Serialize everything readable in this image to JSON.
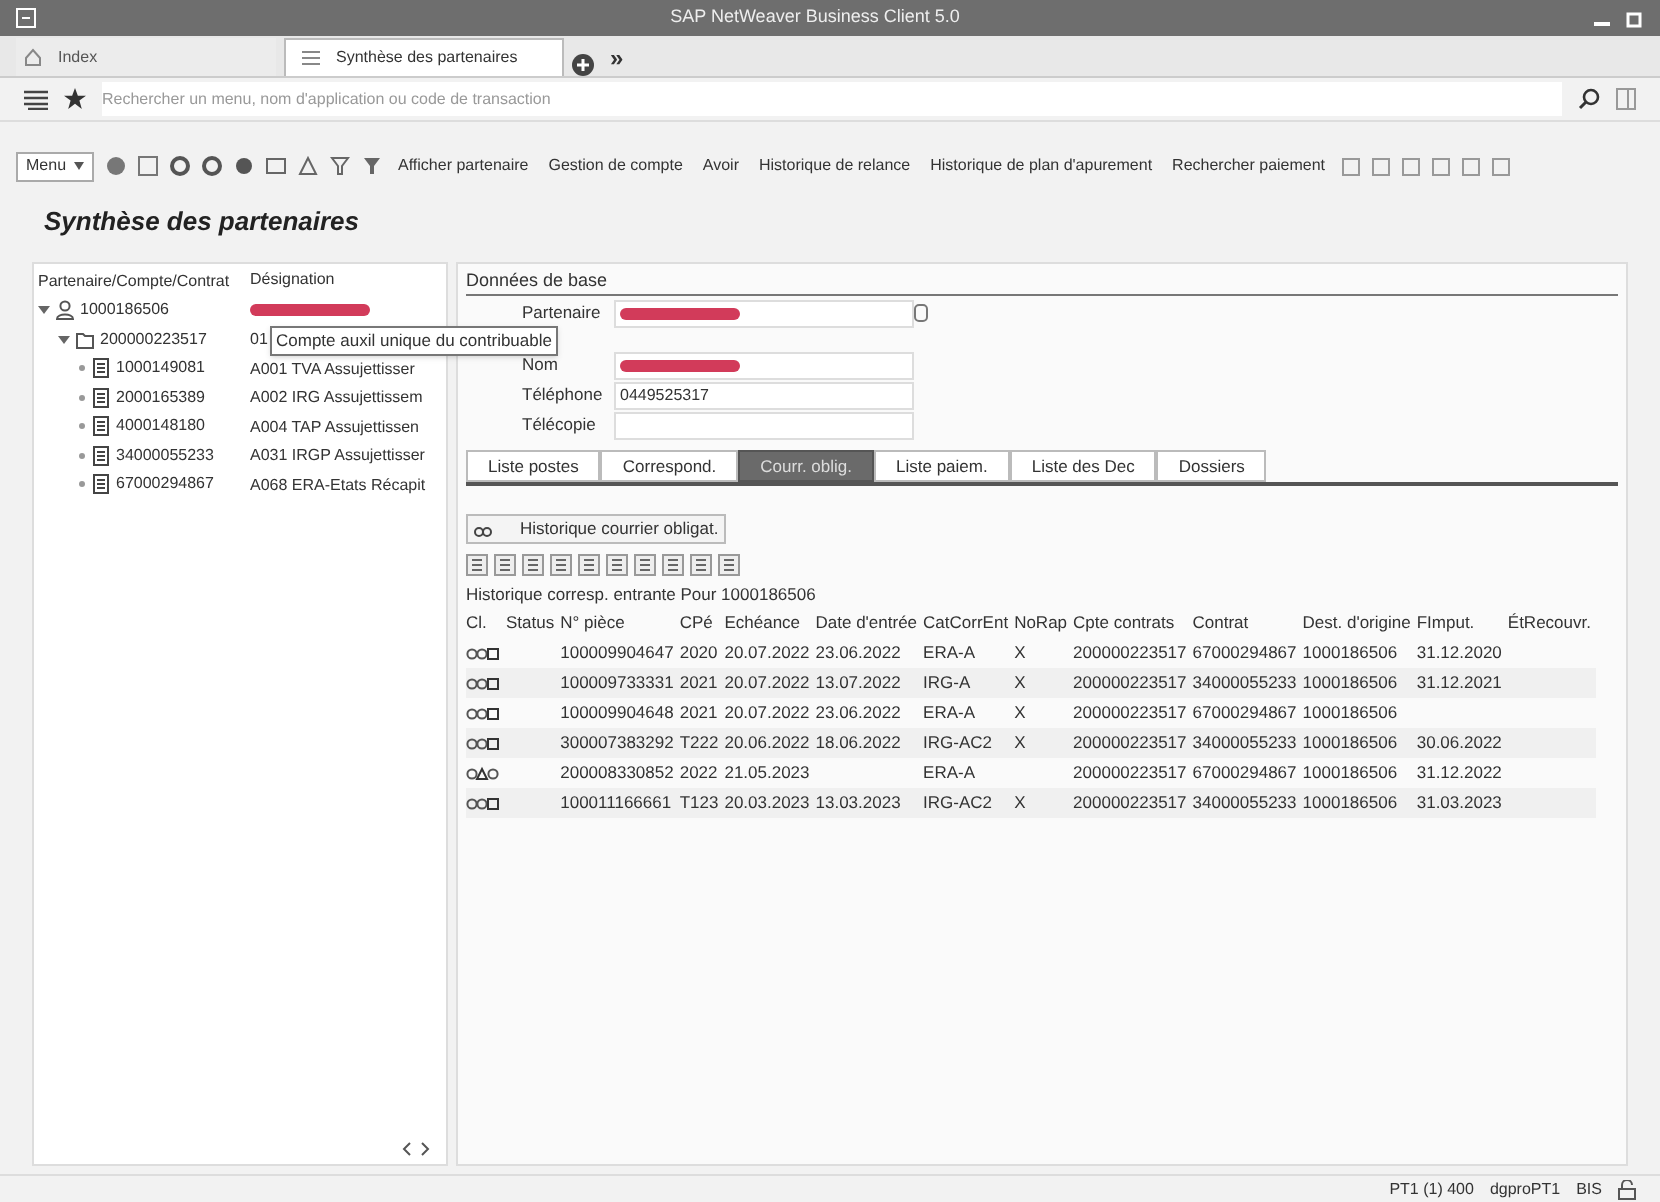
{
  "window": {
    "title": "SAP NetWeaver Business Client 5.0"
  },
  "tabs": [
    {
      "label": "Index",
      "selected": false
    },
    {
      "label": "Synthèse des partenaires",
      "selected": true
    }
  ],
  "more_tabs": "»",
  "search": {
    "placeholder": "Rechercher un menu, nom d'application ou code de transaction"
  },
  "toolbar": {
    "menu": "Menu",
    "buttons": [
      "Afficher partenaire",
      "Gestion de compte",
      "Avoir",
      "Historique de relance",
      "Historique de plan d'apurement",
      "Rechercher paiement"
    ]
  },
  "page_title": "Synthèse des partenaires",
  "tree": {
    "columns": [
      "Partenaire/Compte/Contrat",
      "Désignation"
    ],
    "nodes": [
      {
        "kind": "partner",
        "id": "1000186506",
        "expanded": true,
        "children": [
          {
            "kind": "account",
            "id": "200000223517",
            "designation": "01",
            "expanded": true,
            "children": [
              {
                "kind": "contract",
                "id": "1000149081",
                "designation": "A001 TVA Assujettisser"
              },
              {
                "kind": "contract",
                "id": "2000165389",
                "designation": "A002 IRG Assujettissem"
              },
              {
                "kind": "contract",
                "id": "4000148180",
                "designation": "A004 TAP Assujettissen"
              },
              {
                "kind": "contract",
                "id": "34000055233",
                "designation": "A031 IRGP Assujettisser"
              },
              {
                "kind": "contract",
                "id": "67000294867",
                "designation": "A068 ERA-Etats Récapit"
              }
            ]
          }
        ]
      }
    ]
  },
  "tooltip": "Compte auxil unique du contribuable",
  "basic_data": {
    "title": "Données de base",
    "fields": [
      {
        "label": "Partenaire"
      },
      {
        "label": "Nom"
      },
      {
        "label": "Téléphone",
        "value": "0449525317"
      },
      {
        "label": "Télécopie"
      }
    ]
  },
  "detail_tabs": [
    {
      "label": "Liste postes",
      "selected": false
    },
    {
      "label": "Correspond.",
      "selected": false
    },
    {
      "label": "Courr. oblig.",
      "selected": true
    },
    {
      "label": "Liste paiem.",
      "selected": false
    },
    {
      "label": "Liste des Dec",
      "selected": false
    },
    {
      "label": "Dossiers",
      "selected": false
    }
  ],
  "history_button": "Historique courrier obligat.",
  "table": {
    "title": "Historique corresp. entrante Pour 1000186506",
    "columns": [
      "Cl.",
      "Status",
      "N° pièce",
      "CPé",
      "Echéance",
      "Date d'entrée",
      "CatCorrEnt",
      "NoRap",
      "Cpte contrats",
      "Contrat",
      "Dest. d'origine",
      "FImput.",
      "ÉtRecouvr."
    ],
    "rows": [
      {
        "warning": false,
        "cells": [
          "",
          "",
          "100009904647",
          "2020",
          "20.07.2022",
          "23.06.2022",
          "ERA-A",
          "X",
          "200000223517",
          "67000294867",
          "1000186506",
          "31.12.2020"
        ]
      },
      {
        "warning": false,
        "cells": [
          "",
          "",
          "100009733331",
          "2021",
          "20.07.2022",
          "13.07.2022",
          "IRG-A",
          "X",
          "200000223517",
          "34000055233",
          "1000186506",
          "31.12.2021"
        ]
      },
      {
        "warning": false,
        "cells": [
          "",
          "",
          "100009904648",
          "2021",
          "20.07.2022",
          "23.06.2022",
          "ERA-A",
          "X",
          "200000223517",
          "67000294867",
          "1000186506",
          null
        ]
      },
      {
        "warning": false,
        "cells": [
          "",
          "",
          "300007383292",
          "T222",
          "20.06.2022",
          "18.06.2022",
          "IRG-AC2",
          "X",
          "200000223517",
          "34000055233",
          "1000186506",
          "30.06.2022"
        ]
      },
      {
        "warning": true,
        "cells": [
          "",
          "",
          "200008330852",
          "2022",
          "21.05.2023",
          null,
          "ERA-A",
          null,
          "200000223517",
          "67000294867",
          "1000186506",
          "31.12.2022"
        ]
      },
      {
        "warning": false,
        "cells": [
          "",
          "",
          "100011166661",
          "T123",
          "20.03.2023",
          "13.03.2023",
          "IRG-AC2",
          "X",
          "200000223517",
          "34000055233",
          "1000186506",
          "31.03.2023"
        ]
      }
    ]
  },
  "status_bar": {
    "system": "PT1 (1) 400",
    "user": "dgproPT1",
    "server": "BIS"
  }
}
